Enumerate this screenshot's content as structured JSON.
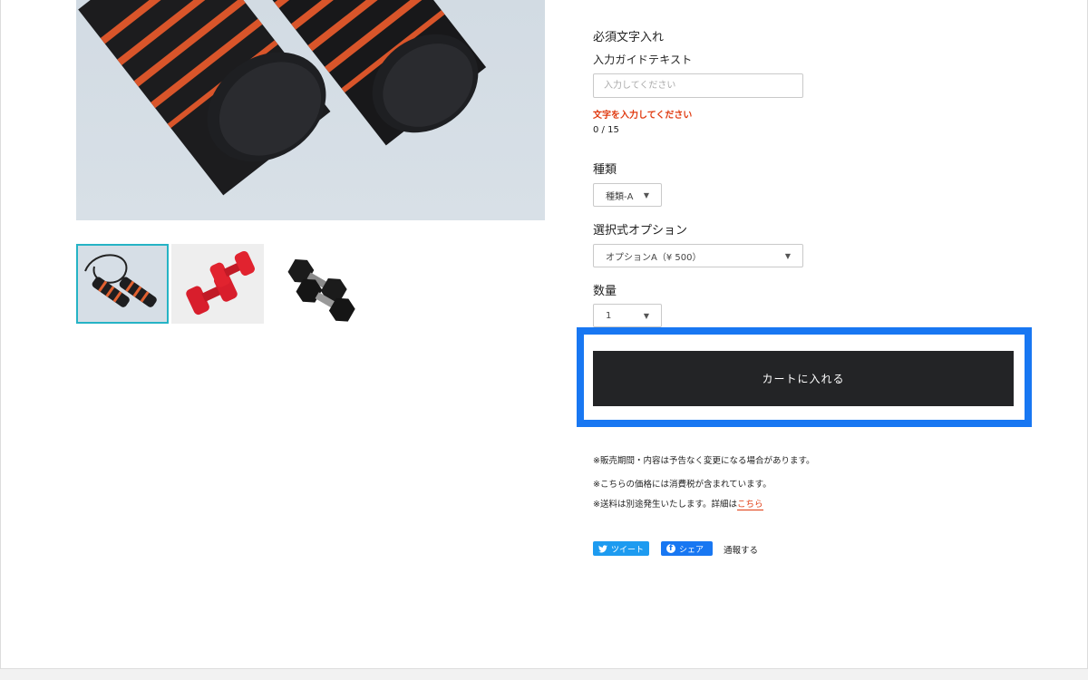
{
  "product_images": {
    "main_alt": "jump-rope-handles",
    "thumbnails": [
      {
        "name": "jump-rope",
        "active": true
      },
      {
        "name": "red-dumbbells",
        "active": false
      },
      {
        "name": "black-dumbbells",
        "active": false
      }
    ]
  },
  "form": {
    "required_text_label": "必須文字入れ",
    "guide_text_label": "入力ガイドテキスト",
    "text_input_placeholder": "入力してください",
    "text_input_value": "",
    "error_message": "文字を入力してください",
    "char_counter": "0 / 15",
    "type_label": "種類",
    "type_selected": "種類-A",
    "option_label": "選択式オプション",
    "option_selected": "オプションA（¥ 500）",
    "quantity_label": "数量",
    "quantity_selected": "1",
    "cart_button_label": "カートに入れる"
  },
  "notes": {
    "line1": "※販売期間・内容は予告なく変更になる場合があります。",
    "line2": "※こちらの価格には消費税が含まれています。",
    "line3_prefix": "※送料は別途発生いたします。詳細は",
    "line3_link": "こちら"
  },
  "social": {
    "tweet_label": "ツイート",
    "share_label": "シェア",
    "report_label": "通報する"
  },
  "colors": {
    "cart_button_bg": "#232426",
    "highlight_border": "#1877f2",
    "error_red": "#e03a10",
    "thumb_active_border": "#25b3c5",
    "twitter_blue": "#1d9bf0",
    "facebook_blue": "#1877f2"
  },
  "icons": {
    "select_caret": "caret-down-icon",
    "twitter": "twitter-bird-icon",
    "facebook": "facebook-f-icon"
  }
}
